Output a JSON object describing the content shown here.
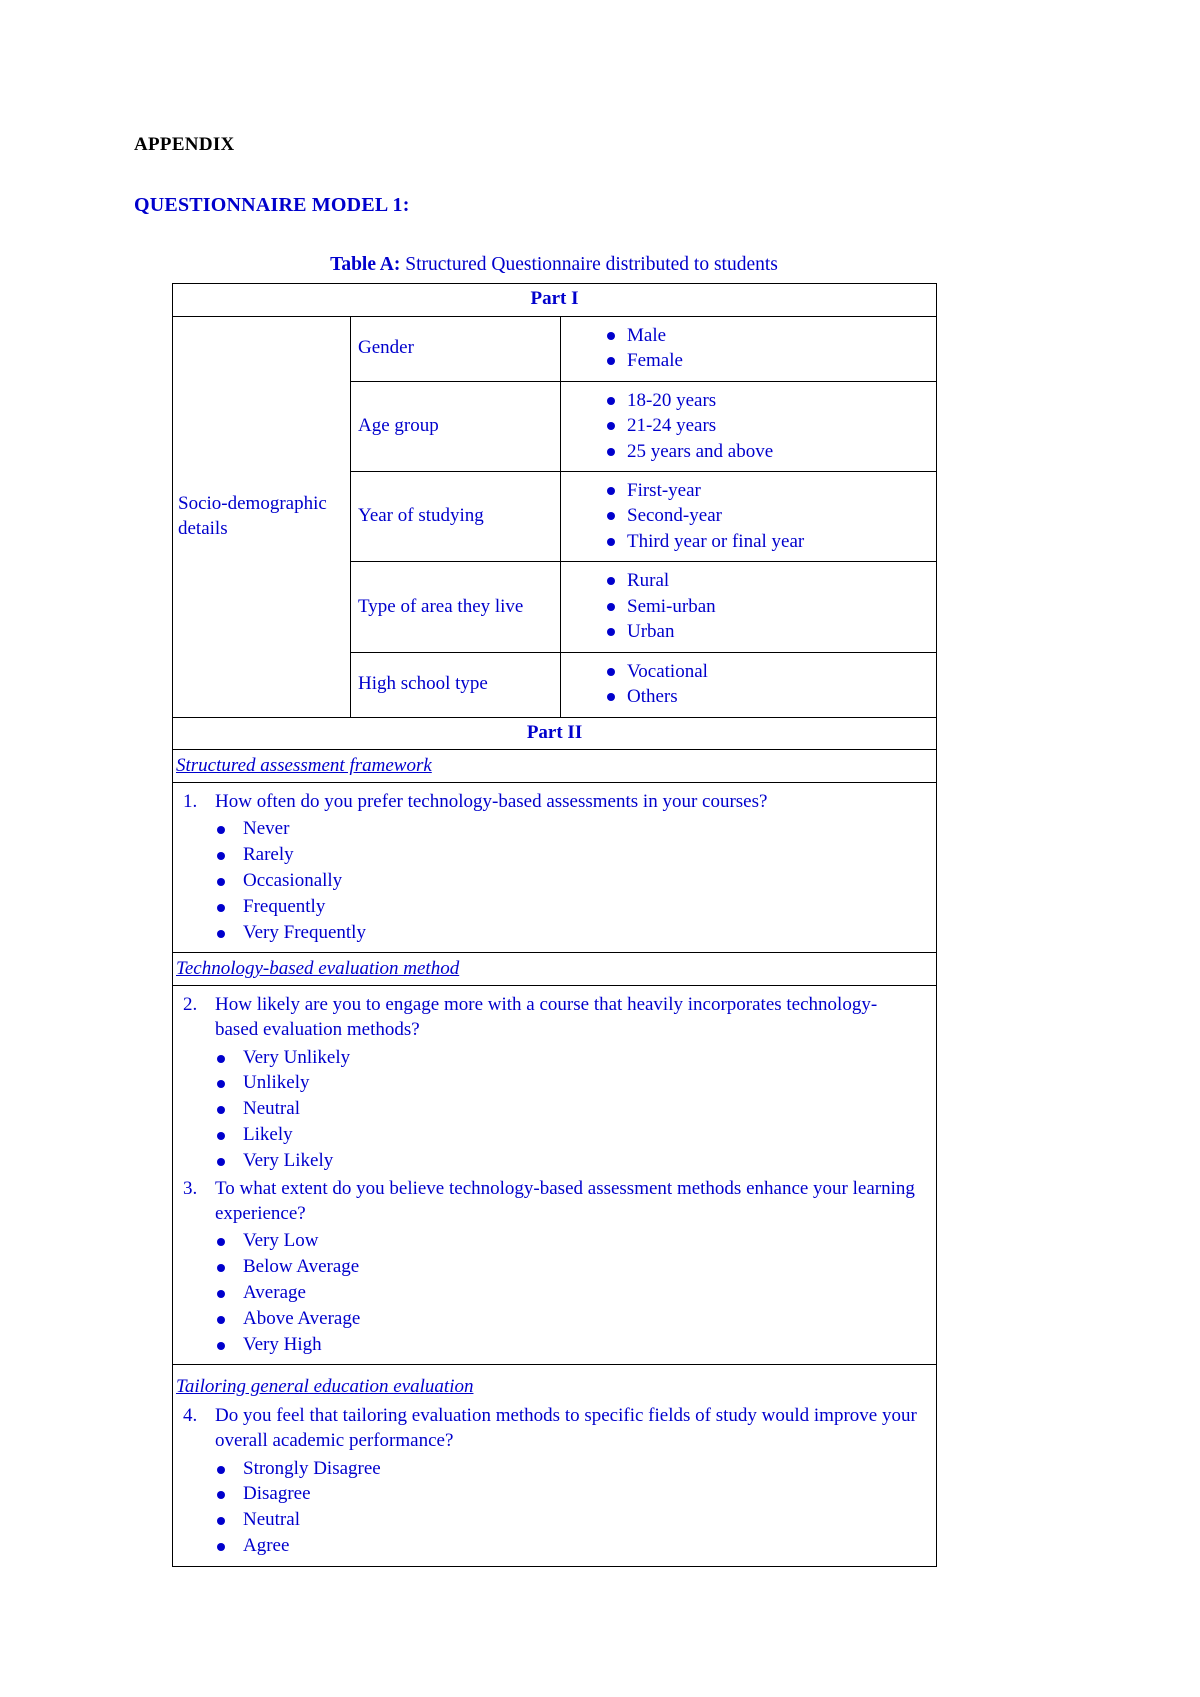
{
  "document": {
    "appendix_heading": "APPENDIX",
    "model_heading": "QUESTIONNAIRE MODEL 1:",
    "caption_label": "Table A:",
    "caption_text": " Structured Questionnaire distributed to students"
  },
  "colors": {
    "text_blue": "#0000CC",
    "text_black": "#000000",
    "border": "#000000"
  },
  "table": {
    "part1": {
      "header": "Part I",
      "group_label": "Socio-demographic details",
      "rows": [
        {
          "label": "Gender",
          "options": [
            "Male",
            "Female"
          ]
        },
        {
          "label": "Age group",
          "options": [
            "18-20 years",
            "21-24 years",
            "25 years and above"
          ]
        },
        {
          "label": "Year of studying",
          "options": [
            "First-year",
            "Second-year",
            "Third year or final year"
          ]
        },
        {
          "label": "Type of area they live",
          "options": [
            "Rural",
            "Semi-urban",
            "Urban"
          ]
        },
        {
          "label": "High school type",
          "options": [
            "Vocational",
            "Others"
          ]
        }
      ]
    },
    "part2": {
      "header": "Part II",
      "sections": [
        {
          "section_title": "Structured assessment framework",
          "questions": [
            {
              "number": "1.",
              "text": "How often do you prefer technology-based assessments in your courses?",
              "options": [
                "Never",
                "Rarely",
                "Occasionally",
                "Frequently",
                "Very Frequently"
              ]
            }
          ]
        },
        {
          "section_title": "Technology-based evaluation method",
          "questions": [
            {
              "number": "2.",
              "text": "How likely are you to engage more with a course that heavily incorporates technology-based evaluation methods?",
              "options": [
                "Very Unlikely",
                "Unlikely",
                "Neutral",
                "Likely",
                "Very Likely"
              ]
            },
            {
              "number": "3.",
              "text": "To what extent do you believe technology-based assessment methods enhance your learning experience?",
              "options": [
                "Very Low",
                "Below Average",
                "Average",
                "Above Average",
                "Very High"
              ]
            }
          ]
        },
        {
          "section_title": "Tailoring general education evaluation",
          "questions": [
            {
              "number": "4.",
              "text": "Do you feel that tailoring evaluation methods to specific fields of study would improve your overall academic performance?",
              "options": [
                "Strongly Disagree",
                "Disagree",
                "Neutral",
                "Agree"
              ]
            }
          ]
        }
      ]
    }
  }
}
